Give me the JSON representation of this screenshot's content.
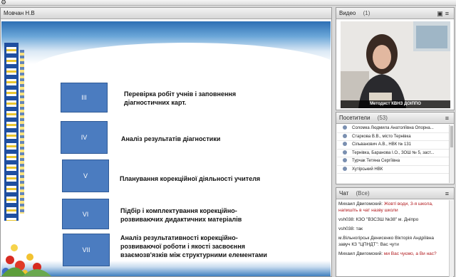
{
  "app": {
    "corner_icon": "settings-icon"
  },
  "share_pod": {
    "title": "Мовчан Н.В",
    "slide": {
      "steps": [
        {
          "num": "III",
          "text": "Перевірка робіт учнів і заповнення діагностичних карт."
        },
        {
          "num": "IV",
          "text": "Аналіз результатів діагностики"
        },
        {
          "num": "V",
          "text": "Планування корекційної діяльності учителя"
        },
        {
          "num": "VI",
          "text": "Підбір і комплектування корекційно-розвиваючих дидактичних матеріалів"
        },
        {
          "num": "VII",
          "text": "Аналіз результативності корекційно-розвиваючої роботи і якості засвоєння взаємозв'язків між структурними елементами"
        }
      ]
    }
  },
  "video_pod": {
    "title": "Видео",
    "count": "(1)",
    "label": "Методист КВНЗ ДОІППО"
  },
  "attendees_pod": {
    "title": "Посетители",
    "count": "(53)",
    "items": [
      "Соломка Людмила Анатоліївна Опорна...",
      "Старкова В.В., місто Тернівка",
      "Сільванович А.В., НВК № 131",
      "Тернівка, Баранова І.О., ЗОШ № 5, заст...",
      "Турчак Тетяна Сергіївна",
      "Хутірський НВК"
    ]
  },
  "chat_pod": {
    "title": "Чат",
    "count": "(Все)",
    "messages": [
      {
        "author": "Михаил Двигомский:",
        "text": "Жовті води, 3-я школа, напишіть в чат назву школи",
        "highlight": true
      },
      {
        "author": "vsh038:",
        "text": "КЗО \"ВЗСЗШ №38\" м. Дніпро",
        "highlight": false
      },
      {
        "author": "vsh038:",
        "text": "так",
        "highlight": false
      },
      {
        "author": "м.Вільногірськ Денисенко Вікторія Андріївна завуч КЗ \"ЦПНДТ\":",
        "text": "Вас чути",
        "highlight": false
      },
      {
        "author": "Михаил Двигомский:",
        "text": "ми Вас чуємо, а Ви нас?",
        "highlight": true
      }
    ]
  },
  "colors": {
    "accent": "#4b7cc0",
    "chat_highlight": "#b1191d"
  }
}
